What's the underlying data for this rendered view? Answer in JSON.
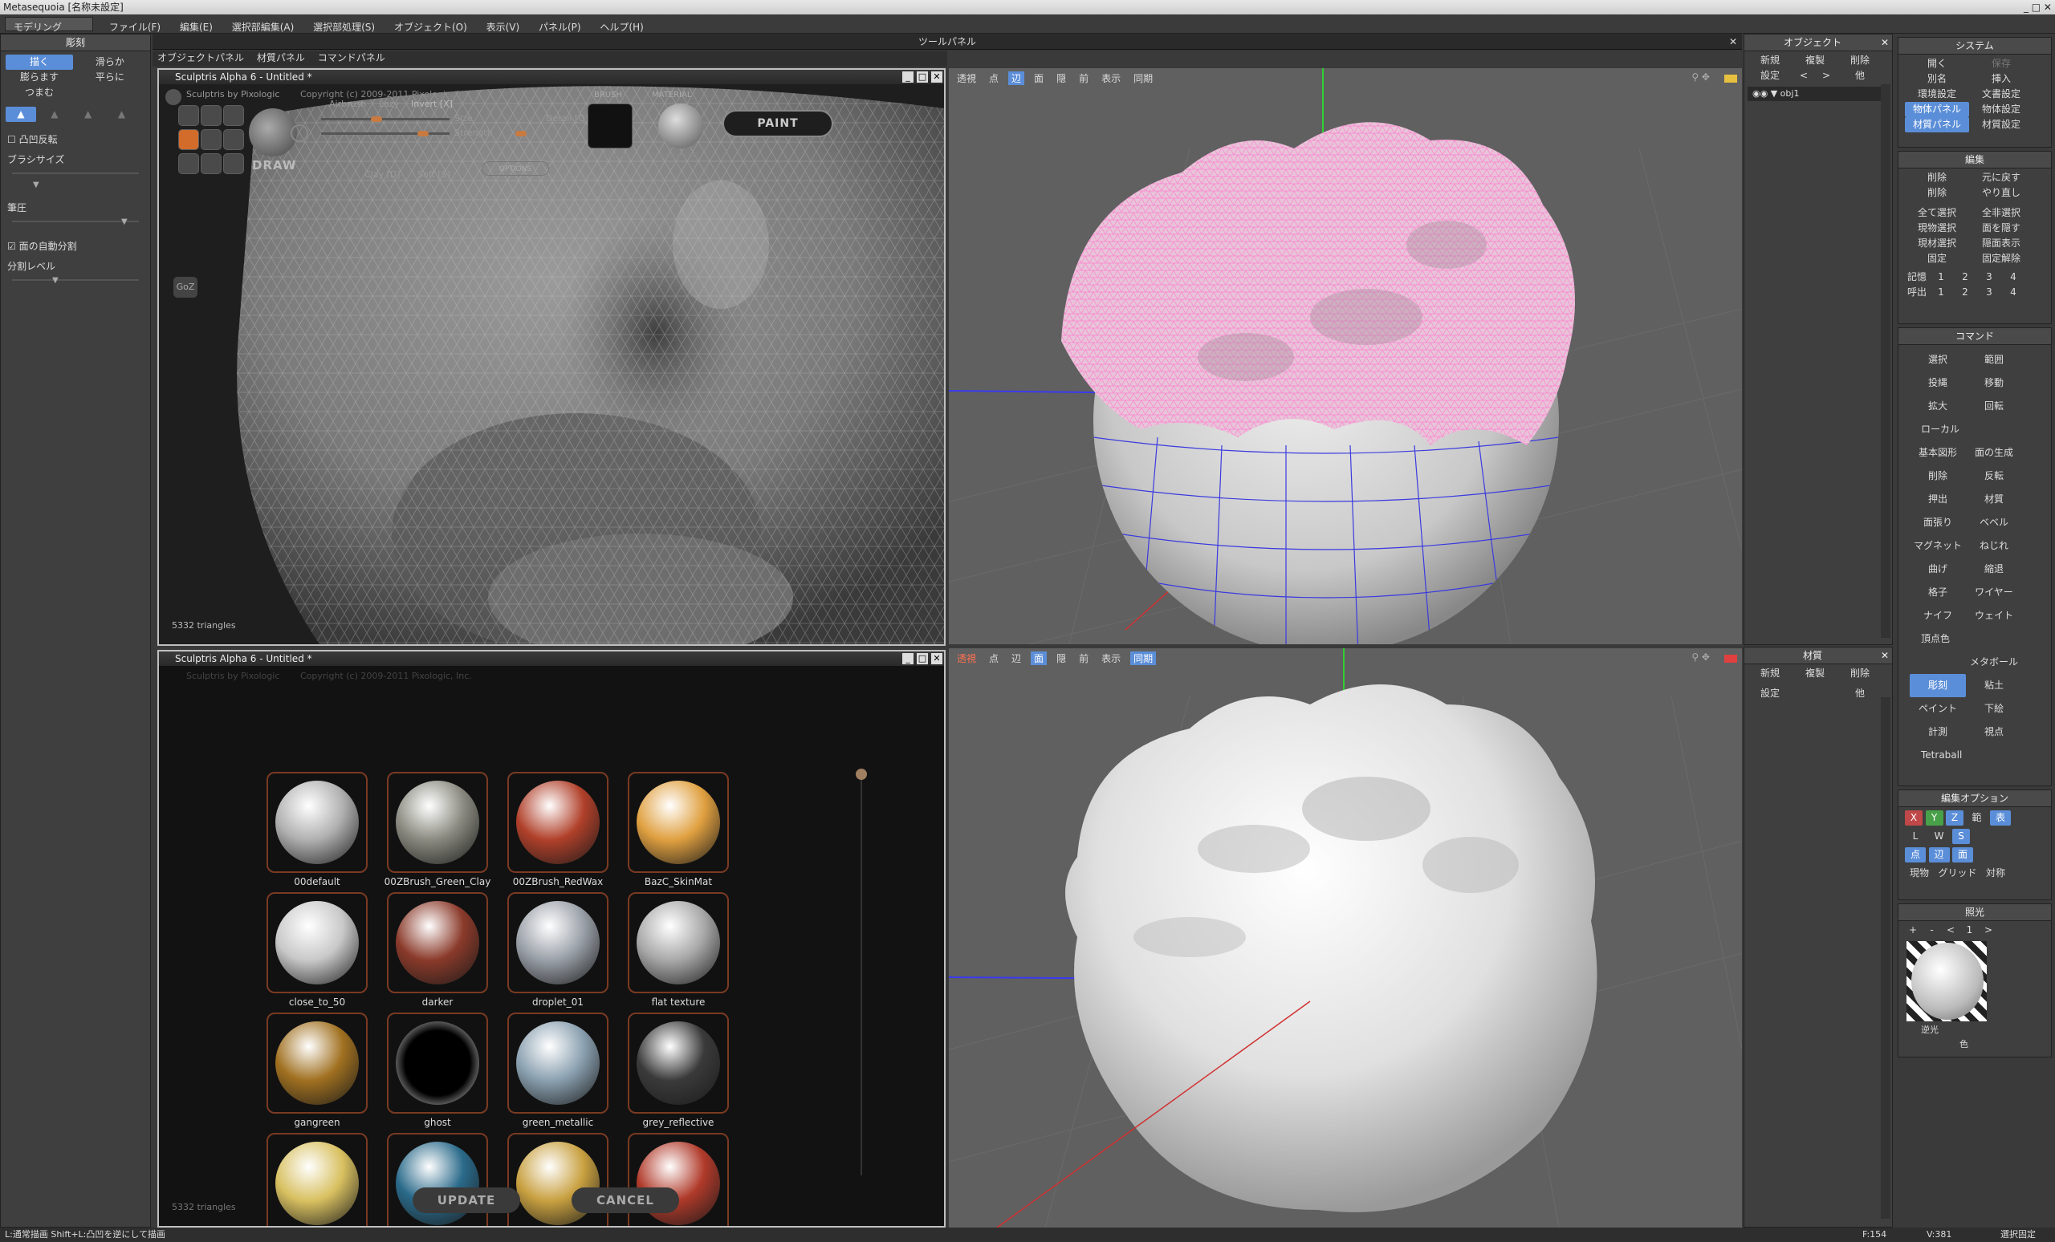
{
  "app": {
    "title": "Metasequoia [名称未設定]"
  },
  "menubar": {
    "mode": "モデリング",
    "items": [
      "ファイル(F)",
      "編集(E)",
      "選択部編集(A)",
      "選択部処理(S)",
      "オブジェクト(O)",
      "表示(V)",
      "パネル(P)",
      "ヘルプ(H)"
    ]
  },
  "left_panel": {
    "title": "彫刻",
    "buttons": [
      "描く",
      "滑らか",
      "膨らます",
      "平らに",
      "つまむ"
    ],
    "invert_label": "凸凹反転",
    "brush_size_label": "ブラシサイズ",
    "pressure_label": "筆圧",
    "auto_split_label": "面の自動分割",
    "split_level_label": "分割レベル"
  },
  "tool_panel": {
    "title": "ツールパネル",
    "tabs": [
      "オブジェクトパネル",
      "材質パネル",
      "コマンドパネル"
    ]
  },
  "sculptris_top": {
    "title": "Sculptris Alpha 6 - Untitled *",
    "brand": "Sculptris by Pixologic",
    "copyright": "Copyright (c) 2009-2011 Pixologic, Inc.",
    "mode": "DRAW",
    "airbrush": "Airbrush",
    "lazy": "Lazy",
    "invert": "Invert [X]",
    "clay": "Clay [D]",
    "soft": "Soft [S]",
    "size": "Size",
    "detail": "Detail [Q]",
    "strength": "Strength",
    "options": "OPTIONS",
    "brush": "BRUSH",
    "material": "MATERIAL",
    "enable": "Enable",
    "material_name": "00default",
    "paint": "PAINT",
    "goz": "GoZ",
    "triangles": "5332 triangles"
  },
  "sculptris_bottom": {
    "title": "Sculptris Alpha 6 - Untitled *",
    "update": "UPDATE",
    "cancel": "CANCEL",
    "triangles": "5332 triangles",
    "materials": [
      {
        "name": "00default",
        "color": "#b0b0b0"
      },
      {
        "name": "00ZBrush_Green_Clay",
        "color": "#8a8a80"
      },
      {
        "name": "00ZBrush_RedWax",
        "color": "#b0402a"
      },
      {
        "name": "BazC_SkinMat",
        "color": "#e0a040"
      },
      {
        "name": "close_to_50",
        "color": "#c8c8c8"
      },
      {
        "name": "darker",
        "color": "#8a3a2a"
      },
      {
        "name": "droplet_01",
        "color": "#9aa0a8"
      },
      {
        "name": "flat texture",
        "color": "#a8a8a8"
      },
      {
        "name": "gangreen",
        "color": "#a07020"
      },
      {
        "name": "ghost",
        "color": "#000000"
      },
      {
        "name": "green_metallic",
        "color": "#8aa0b0"
      },
      {
        "name": "grey_reflective",
        "color": "#3a3a3a"
      },
      {
        "name": "",
        "color": "#d8c060"
      },
      {
        "name": "",
        "color": "#2a6a8a"
      },
      {
        "name": "",
        "color": "#c8a040"
      },
      {
        "name": "",
        "color": "#b03a2a"
      }
    ]
  },
  "viewport_top": {
    "tools": [
      "透視",
      "点",
      "辺",
      "面",
      "隠",
      "前",
      "表示",
      "同期"
    ],
    "active": [
      2
    ]
  },
  "viewport_bottom": {
    "tools": [
      "透視",
      "点",
      "辺",
      "面",
      "隠",
      "前",
      "表示",
      "同期"
    ],
    "active": [
      3,
      7
    ]
  },
  "object_panel": {
    "title": "オブジェクト",
    "buttons": [
      "新規",
      "複製",
      "削除",
      "設定",
      "<",
      ">",
      "他"
    ],
    "object_name": "obj1"
  },
  "material_panel": {
    "title": "材質",
    "buttons": [
      "新規",
      "複製",
      "削除",
      "設定",
      "他"
    ]
  },
  "system_panel": {
    "title": "システム",
    "buttons": [
      "開く",
      "保存",
      "別名",
      "挿入",
      "環境設定",
      "文書設定",
      "物体パネル",
      "物体設定",
      "材質パネル",
      "材質設定"
    ]
  },
  "edit_panel": {
    "title": "編集",
    "buttons": [
      "削除",
      "元に戻す",
      "削除",
      "やり直し",
      "全て選択",
      "全非選択",
      "現物選択",
      "面を隠す",
      "現材選択",
      "隠面表示",
      "固定",
      "固定解除"
    ],
    "memory_label": "記憶",
    "recall_label": "呼出",
    "slots": [
      "1",
      "2",
      "3",
      "4"
    ]
  },
  "command_panel": {
    "title": "コマンド",
    "buttons": [
      "選択",
      "範囲",
      "投縄",
      "移動",
      "拡大",
      "回転",
      "ローカル",
      "基本図形",
      "面の生成",
      "削除",
      "反転",
      "押出",
      "材質",
      "面張り",
      "ベベル",
      "マグネット",
      "ねじれ",
      "曲げ",
      "縮退",
      "格子",
      "ワイヤー",
      "ナイフ",
      "ウェイト",
      "頂点色",
      "彫刻",
      "メタボール粘土",
      "ペイント",
      "下絵",
      "計測",
      "視点",
      "Tetraball"
    ]
  },
  "edit_option_panel": {
    "title": "編集オプション",
    "axes": [
      "X",
      "Y",
      "Z"
    ],
    "others": [
      "範",
      "表",
      "L",
      "W",
      "S",
      "点",
      "辺",
      "面",
      "現物",
      "グリッド",
      "対称"
    ]
  },
  "light_panel": {
    "title": "照光",
    "controls": [
      "+",
      "-",
      "<",
      "1",
      ">"
    ],
    "backlight": "逆光",
    "color": "色"
  },
  "status": {
    "hint": "L:通常描画  Shift+L:凸凹を逆にして描画",
    "face_count": "F:154",
    "vertex_count": "V:381",
    "mode": "選択固定"
  }
}
